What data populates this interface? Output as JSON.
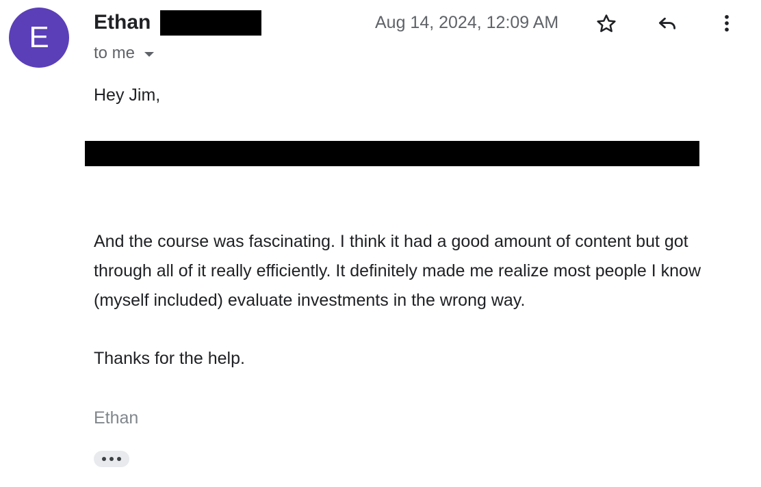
{
  "header": {
    "avatar_letter": "E",
    "avatar_color": "#5b3fb8",
    "sender_name": "Ethan",
    "recipient_label": "to me",
    "date": "Aug 14, 2024, 12:09 AM",
    "icons": {
      "star": "star-icon",
      "reply": "reply-icon",
      "more": "more-vert-icon",
      "recipient_dropdown": "caret-down-icon"
    }
  },
  "message": {
    "greeting": "Hey Jim,",
    "paragraph": "And the course was fascinating. I think it had a good amount of content but got through all of it really efficiently. It definitely made me realize most people I know (myself included) evaluate investments in the wrong way.",
    "thanks": "Thanks for the help.",
    "signature": "Ethan"
  }
}
